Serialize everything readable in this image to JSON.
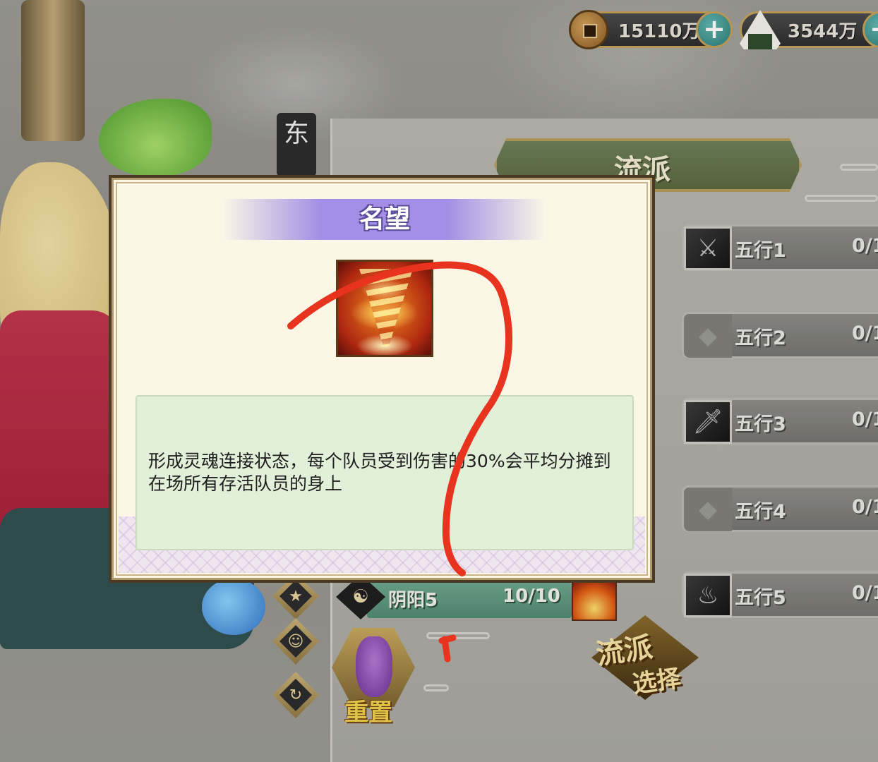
{
  "currency": {
    "copper": {
      "icon": "coin-icon",
      "value": "15110万"
    },
    "rice": {
      "icon": "rice-ball-icon",
      "value": "3544万"
    }
  },
  "banner": {
    "title": "流派"
  },
  "side_sign": {
    "text": "东"
  },
  "wuxing": [
    {
      "label": "五行1",
      "count": "0/1",
      "icon": "slash-skill-icon",
      "locked": false
    },
    {
      "label": "五行2",
      "count": "0/1",
      "icon": "empty-slot-icon",
      "locked": true
    },
    {
      "label": "五行3",
      "count": "0/1",
      "icon": "sword-skill-icon",
      "locked": false
    },
    {
      "label": "五行4",
      "count": "0/1",
      "icon": "empty-slot-icon",
      "locked": true
    },
    {
      "label": "五行5",
      "count": "0/1",
      "icon": "flame-skill-icon",
      "locked": false
    }
  ],
  "yinyang": {
    "label": "阴阳5",
    "count": "10/10"
  },
  "reset": {
    "label": "重置"
  },
  "school_select": {
    "line1": "流派",
    "line2": "选择"
  },
  "modal": {
    "title": "名望",
    "skill_icon": "fire-tornado-icon",
    "description": "形成灵魂连接状态，每个队员受到伤害的30%会平均分摊到在场所有存活队员的身上"
  },
  "colors": {
    "annotation_red": "#e8331f",
    "modal_title_bar": "#a58fe6",
    "desc_bg": "#e2efd9",
    "yinyang_bar": "#5f9a80"
  }
}
